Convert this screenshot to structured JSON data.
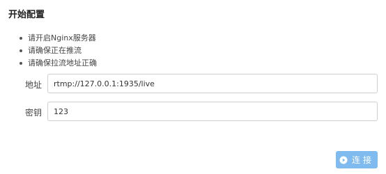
{
  "header": {
    "title": "开始配置"
  },
  "instructions": [
    "请开启Nginx服务器",
    "请确保正在推流",
    "请确保拉流地址正确"
  ],
  "form": {
    "address": {
      "label": "地址",
      "value": "rtmp://127.0.0.1:1935/live"
    },
    "key": {
      "label": "密钥",
      "value": "123"
    }
  },
  "actions": {
    "connect_label": "连接",
    "connect_icon": "play-circle-icon"
  },
  "colors": {
    "accent": "#7fbbee"
  }
}
